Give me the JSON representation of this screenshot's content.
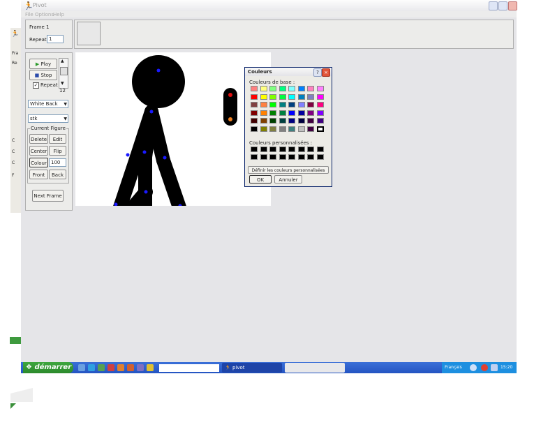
{
  "window": {
    "title": "Pivot",
    "menu": [
      "File",
      "Options",
      "Help"
    ]
  },
  "frame": {
    "label": "Frame 1",
    "repeat_label": "Repeat :",
    "repeat_value": "1"
  },
  "far_left": {
    "labels": [
      "Fra",
      "Re",
      "C",
      "C",
      "C",
      "F"
    ]
  },
  "controls": {
    "play": "Play",
    "stop": "Stop",
    "repeat": "Repeat",
    "speed": "12",
    "background_select": "White Back",
    "figure_select": "stk",
    "current_figure": "Current Figure",
    "delete": "Delete",
    "edit": "Edit",
    "center": "Center",
    "flip": "Flip",
    "colour": "Colour",
    "opacity": "100",
    "front": "Front",
    "back": "Back",
    "next_frame": "Next Frame"
  },
  "dialog": {
    "title": "Couleurs",
    "basic_label": "Couleurs de base :",
    "custom_label": "Couleurs personnalisées :",
    "define_button": "Définir les couleurs personnalisées >>",
    "ok": "OK",
    "cancel": "Annuler",
    "basic_colors": [
      [
        "#ff8080",
        "#ffff80",
        "#80ff80",
        "#00ff80",
        "#80ffff",
        "#0080ff",
        "#ff80c0",
        "#ff80ff"
      ],
      [
        "#ff0000",
        "#ffff00",
        "#80ff00",
        "#00ff40",
        "#00ffff",
        "#0080c0",
        "#8080c0",
        "#ff00ff"
      ],
      [
        "#804040",
        "#ff8040",
        "#00ff00",
        "#008080",
        "#004080",
        "#8080ff",
        "#800040",
        "#ff0080"
      ],
      [
        "#800000",
        "#ff8000",
        "#008000",
        "#008040",
        "#0000ff",
        "#0000a0",
        "#800080",
        "#8000ff"
      ],
      [
        "#400000",
        "#804000",
        "#004000",
        "#004040",
        "#000080",
        "#000040",
        "#400040",
        "#400080"
      ],
      [
        "#000000",
        "#808000",
        "#808040",
        "#808080",
        "#408080",
        "#c0c0c0",
        "#400040",
        "#ffffff"
      ]
    ]
  },
  "taskbar": {
    "start": "démarrer",
    "task": "pivot",
    "tray_text": "Français",
    "clock": "15:20"
  }
}
